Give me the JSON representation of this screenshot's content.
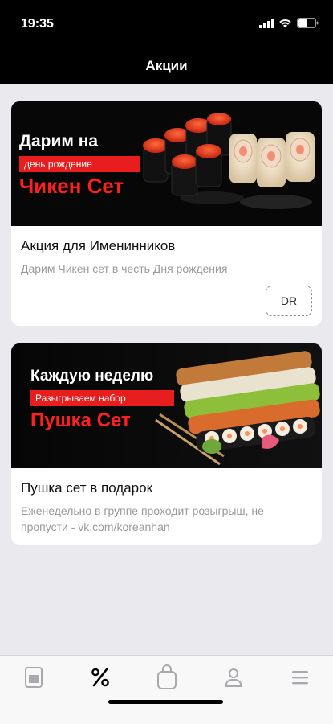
{
  "status_bar": {
    "time": "19:35"
  },
  "header": {
    "title": "Акции"
  },
  "promos": [
    {
      "banner": {
        "line1": "Дарим на",
        "pill": "день рождение",
        "big": "Чикен Сет"
      },
      "title": "Акция для Именинников",
      "description": "Дарим Чикен сет в честь Дня рождения",
      "code": "DR"
    },
    {
      "banner": {
        "line1": "Каждую неделю",
        "pill": "Разыгрываем набор",
        "big": "Пушка Сет"
      },
      "title": "Пушка сет в подарок",
      "description": "Еженедельно в группе проходит розыгрыш, не пропусти - vk.com/koreanhan"
    }
  ],
  "tab_bar": {
    "tabs": [
      {
        "icon": "menu-card-icon",
        "active": false
      },
      {
        "icon": "percent-icon",
        "active": true
      },
      {
        "icon": "bag-icon",
        "active": false
      },
      {
        "icon": "profile-icon",
        "active": false
      },
      {
        "icon": "hamburger-icon",
        "active": false
      }
    ]
  }
}
